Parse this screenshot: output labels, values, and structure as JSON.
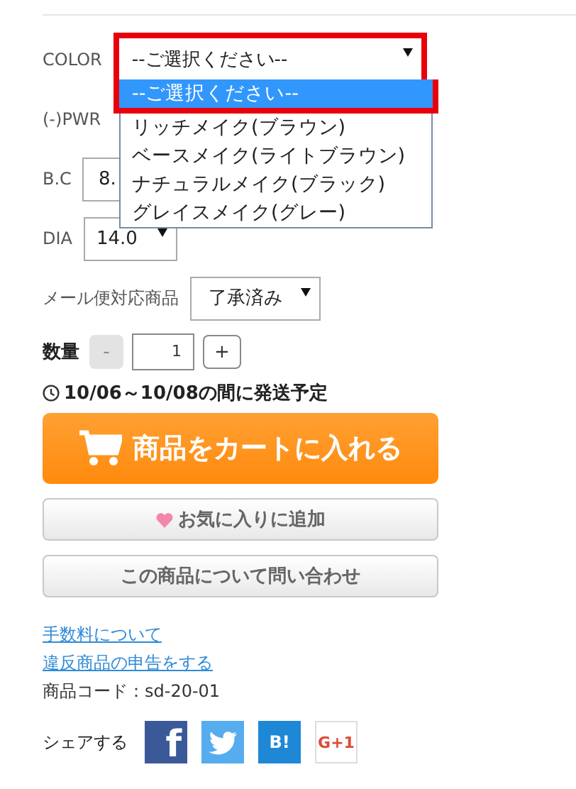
{
  "options": [
    {
      "label": "COLOR",
      "kind": "select",
      "value": "--ご選択ください--",
      "focused": true,
      "dropdown": [
        {
          "label": "--ご選択ください--",
          "selected": true
        },
        {
          "label": "リッチメイク(ブラウン)",
          "selected": false
        },
        {
          "label": "ベースメイク(ライトブラウン)",
          "selected": false
        },
        {
          "label": "ナチュラルメイク(ブラック)",
          "selected": false
        },
        {
          "label": "グレイスメイク(グレー)",
          "selected": false
        }
      ]
    },
    {
      "label": "(-)PWR",
      "kind": "hidden"
    },
    {
      "label": "B.C",
      "kind": "select_covered",
      "value": "8.",
      "focused": false
    },
    {
      "label": "DIA",
      "kind": "select",
      "value": "14.0",
      "focused": false
    },
    {
      "label": "メール便対応商品",
      "kind": "select",
      "value": "了承済み",
      "focused": false
    }
  ],
  "quantity": {
    "label": "数量",
    "minus": "-",
    "value": "1",
    "plus": "+",
    "minus_disabled": true
  },
  "shipping": "10/06～10/08の間に発送予定",
  "cart_button": "商品をカートに入れる",
  "favorite_button": "お気に入りに追加",
  "inquiry_button": "この商品について問い合わせ",
  "links": [
    "手数料について",
    "違反商品の申告をする"
  ],
  "product_code": "商品コード：sd-20-01",
  "share": {
    "label": "シェアする",
    "buttons": [
      {
        "kind": "facebook",
        "text": "f"
      },
      {
        "kind": "twitter"
      },
      {
        "kind": "hatena",
        "text": "B!"
      },
      {
        "kind": "google",
        "text": "G+1"
      }
    ]
  }
}
